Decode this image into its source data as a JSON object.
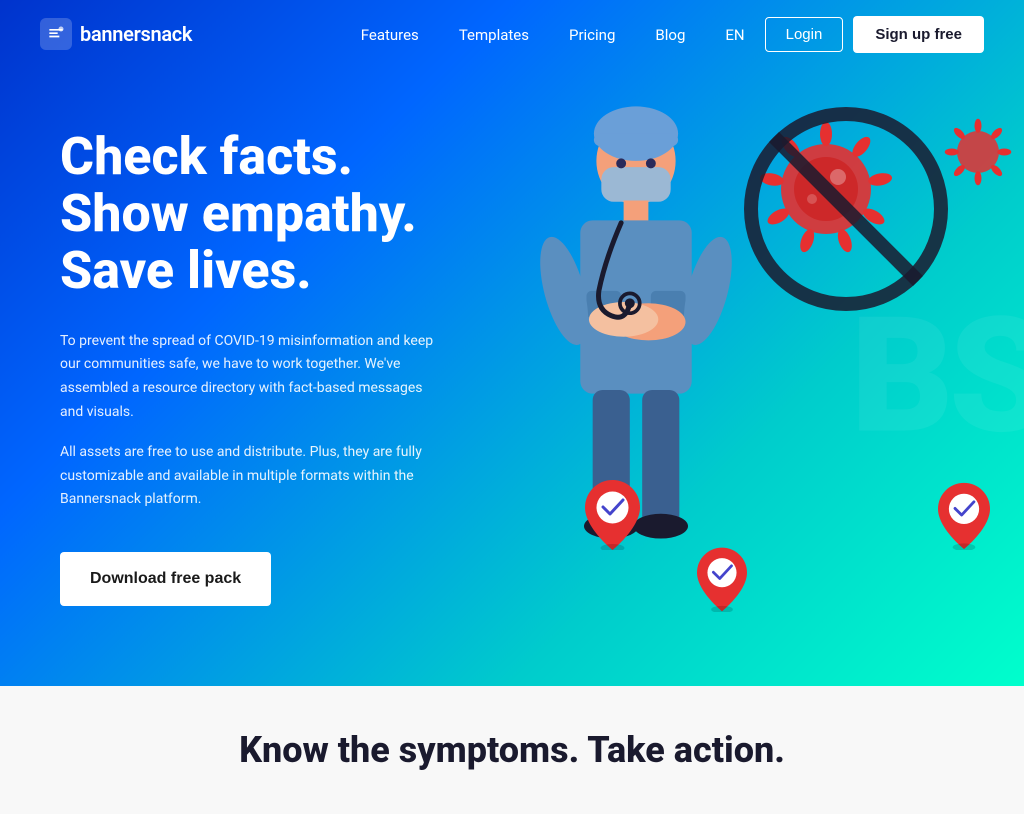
{
  "brand": {
    "name": "bannersnack",
    "logo_alt": "bannersnack logo"
  },
  "nav": {
    "links": [
      {
        "label": "Features",
        "href": "#"
      },
      {
        "label": "Templates",
        "href": "#"
      },
      {
        "label": "Pricing",
        "href": "#"
      },
      {
        "label": "Blog",
        "href": "#"
      },
      {
        "label": "EN",
        "href": "#"
      }
    ],
    "login_label": "Login",
    "signup_label": "Sign up free"
  },
  "hero": {
    "heading_line1": "Check facts.",
    "heading_line2": "Show empathy.",
    "heading_line3": "Save lives.",
    "body1": "To prevent the spread of COVID-19 misinformation and keep our communities safe, we have to work together. We've assembled a resource directory with fact-based messages and visuals.",
    "body2": "All assets are free to use and distribute. Plus, they are fully customizable and available in multiple formats within the Bannersnack platform.",
    "cta_label": "Download free pack"
  },
  "bottom": {
    "heading": "Know the symptoms. Take action."
  },
  "colors": {
    "hero_gradient_start": "#0033cc",
    "hero_gradient_end": "#00ffcc",
    "accent": "#00ccaa",
    "white": "#ffffff",
    "dark": "#1a1a2e"
  }
}
